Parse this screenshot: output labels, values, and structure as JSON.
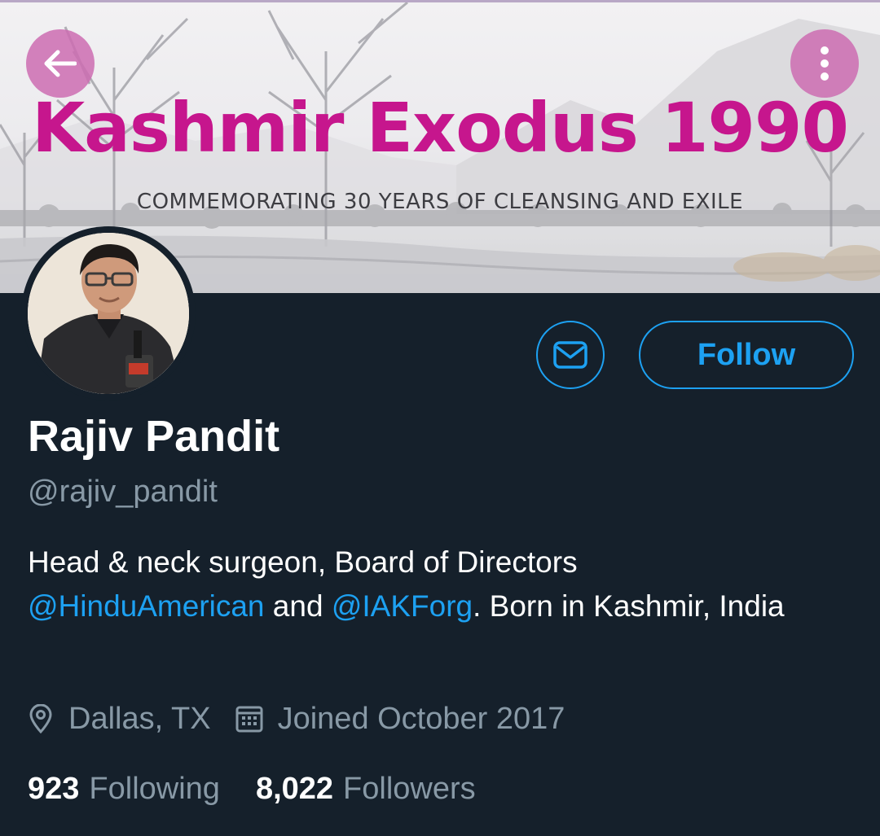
{
  "banner": {
    "title": "Kashmir Exodus 1990",
    "subtitle": "COMMEMORATING 30 YEARS OF CLEANSING AND EXILE",
    "title_color": "#c6168d",
    "button_color": "#cc6cb2"
  },
  "nav": {
    "back_icon": "arrow-left-icon",
    "more_icon": "more-vertical-icon"
  },
  "actions": {
    "message_icon": "envelope-icon",
    "follow_label": "Follow"
  },
  "profile": {
    "name": "Rajiv Pandit",
    "handle": "@rajiv_pandit",
    "bio_prefix": "Head & neck surgeon, Board of Directors",
    "bio_mention_1": "@HinduAmerican",
    "bio_and": " and ",
    "bio_mention_2": "@IAKForg",
    "bio_suffix": ". Born in Kashmir, India",
    "location": "Dallas, TX",
    "location_icon": "location-pin-icon",
    "joined": "Joined October 2017",
    "joined_icon": "calendar-icon",
    "following_count": "923",
    "following_label": "Following",
    "followers_count": "8,022",
    "followers_label": "Followers"
  },
  "colors": {
    "background": "#15202b",
    "accent": "#1da1f2",
    "secondary_text": "#8899a6",
    "primary_text": "#ffffff"
  }
}
